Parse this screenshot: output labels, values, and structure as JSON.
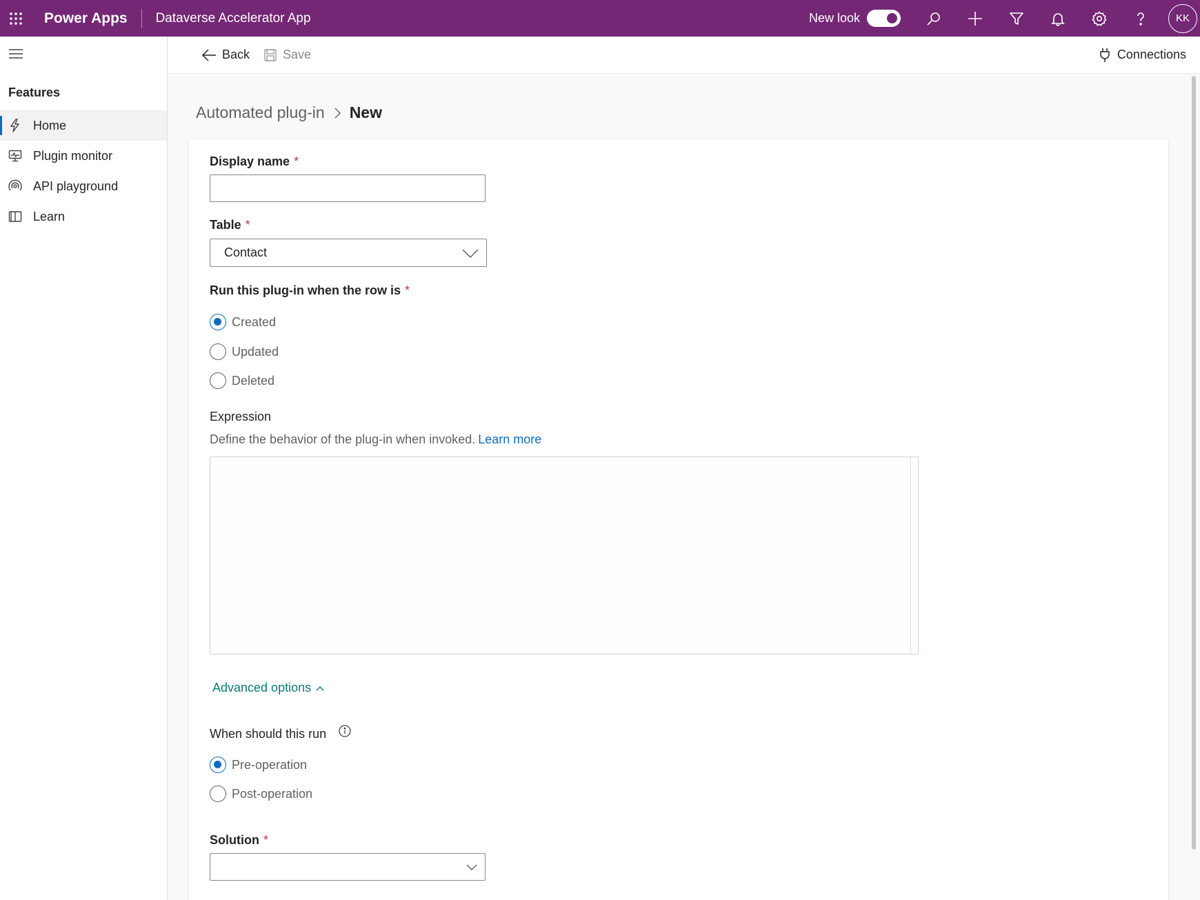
{
  "topbar": {
    "brand": "Power Apps",
    "app_name": "Dataverse Accelerator App",
    "new_look_label": "New look",
    "avatar_initials": "KK"
  },
  "sidebar": {
    "heading": "Features",
    "items": [
      {
        "label": "Home",
        "icon": "lightning-icon"
      },
      {
        "label": "Plugin monitor",
        "icon": "monitor-icon"
      },
      {
        "label": "API playground",
        "icon": "radio-waves-icon"
      },
      {
        "label": "Learn",
        "icon": "book-icon"
      }
    ]
  },
  "command_bar": {
    "back_label": "Back",
    "save_label": "Save",
    "connections_label": "Connections"
  },
  "breadcrumb": {
    "parent": "Automated plug-in",
    "current": "New"
  },
  "form": {
    "display_name": {
      "label": "Display name",
      "required": "*",
      "value": ""
    },
    "table": {
      "label": "Table",
      "required": "*",
      "value": "Contact"
    },
    "run_when": {
      "label": "Run this plug-in when the row is",
      "required": "*",
      "options": [
        "Created",
        "Updated",
        "Deleted"
      ],
      "selected": "Created"
    },
    "expression": {
      "label": "Expression",
      "description": "Define the behavior of the plug-in when invoked.",
      "learn_more": "Learn more",
      "value": ""
    },
    "advanced_options_label": "Advanced options",
    "when_run": {
      "label": "When should this run",
      "options": [
        "Pre-operation",
        "Post-operation"
      ],
      "selected": "Pre-operation"
    },
    "solution": {
      "label": "Solution",
      "required": "*",
      "value": ""
    }
  },
  "colors": {
    "header": "#742774",
    "accent": "#0f6cbd",
    "link_teal": "#0b7a75",
    "required": "#c4314b"
  }
}
